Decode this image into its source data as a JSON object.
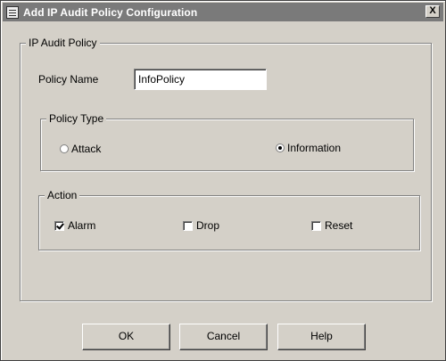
{
  "window": {
    "title": "Add IP Audit Policy Configuration",
    "close_label": "X"
  },
  "group_policy": {
    "legend": "IP Audit Policy",
    "policy_name_label": "Policy Name",
    "policy_name_value": "InfoPolicy"
  },
  "policy_type": {
    "legend": "Policy Type",
    "options": [
      {
        "label": "Attack",
        "selected": false
      },
      {
        "label": "Information",
        "selected": true
      }
    ]
  },
  "action": {
    "legend": "Action",
    "options": [
      {
        "label": "Alarm",
        "checked": true
      },
      {
        "label": "Drop",
        "checked": false
      },
      {
        "label": "Reset",
        "checked": false
      }
    ]
  },
  "buttons": {
    "ok": "OK",
    "cancel": "Cancel",
    "help": "Help"
  }
}
